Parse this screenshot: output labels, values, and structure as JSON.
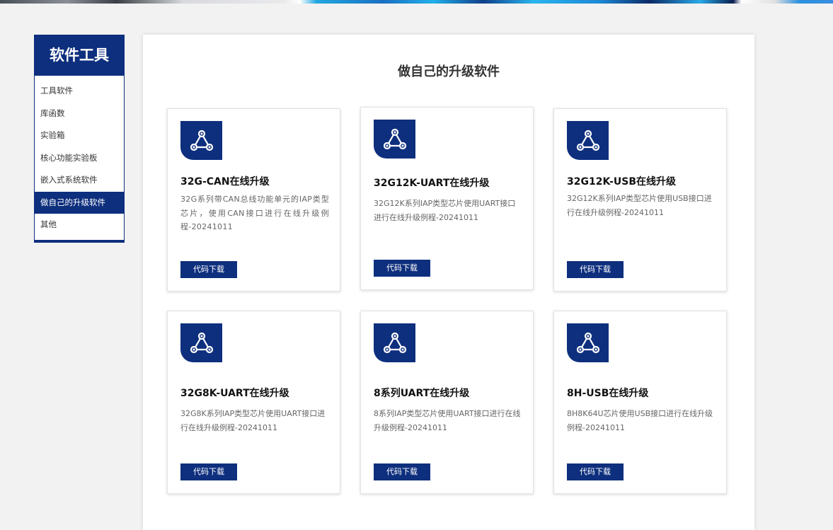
{
  "sidebar": {
    "title": "软件工具",
    "items": [
      {
        "label": "工具软件",
        "active": false
      },
      {
        "label": "库函数",
        "active": false
      },
      {
        "label": "实验箱",
        "active": false
      },
      {
        "label": "核心功能实验板",
        "active": false
      },
      {
        "label": "嵌入式系统软件",
        "active": false
      },
      {
        "label": "做自己的升级软件",
        "active": true
      },
      {
        "label": "其他",
        "active": false
      }
    ]
  },
  "main": {
    "title": "做自己的升级软件",
    "cards": [
      {
        "icon": "share-nodes-icon",
        "title": "32G-CAN在线升级",
        "description": "32G系列带CAN总线功能单元的IAP类型芯片，使用CAN接口进行在线升级例程-20241011",
        "button_label": "代码下载"
      },
      {
        "icon": "share-nodes-icon",
        "title": "32G12K-UART在线升级",
        "description": "32G12K系列IAP类型芯片使用UART接口进行在线升级例程-20241011",
        "button_label": "代码下载"
      },
      {
        "icon": "share-nodes-icon",
        "title": "32G12K-USB在线升级",
        "description": "32G12K系列IAP类型芯片使用USB接口进行在线升级例程-20241011",
        "button_label": "代码下载"
      },
      {
        "icon": "share-nodes-icon",
        "title": "32G8K-UART在线升级",
        "description": "32G8K系列IAP类型芯片使用UART接口进行在线升级例程-20241011",
        "button_label": "代码下载"
      },
      {
        "icon": "share-nodes-icon",
        "title": "8系列UART在线升级",
        "description": "8系列IAP类型芯片使用UART接口进行在线升级例程-20241011",
        "button_label": "代码下载"
      },
      {
        "icon": "share-nodes-icon",
        "title": "8H-USB在线升级",
        "description": "8H8K64U芯片使用USB接口进行在线升级例程-20241011",
        "button_label": "代码下载"
      }
    ]
  },
  "colors": {
    "brand": "#0e2f7e",
    "background": "#f2f2f2",
    "card_background": "#ffffff"
  }
}
